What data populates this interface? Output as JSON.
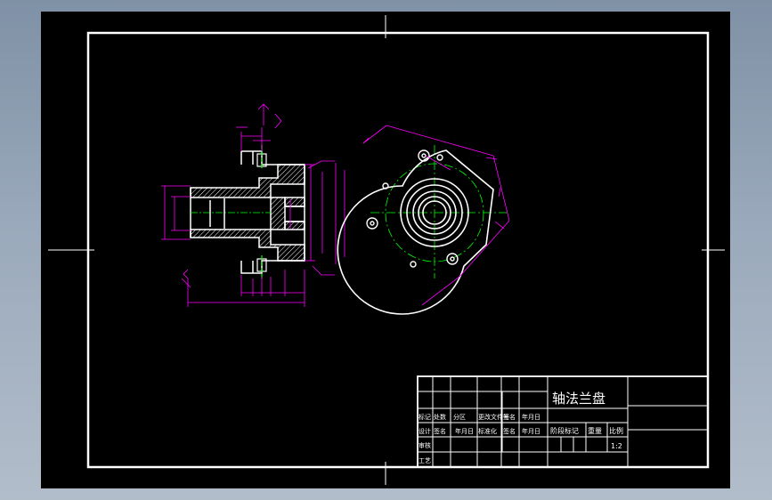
{
  "title_block": {
    "part_name": "轴法兰盘",
    "row_a": [
      "标记",
      "处数",
      "分区",
      "更改文件号",
      "签名",
      "年月日"
    ],
    "row_b": [
      "设计",
      "签名",
      "年月日",
      "标准化",
      "签名",
      "年月日"
    ],
    "row_c": [
      "审核"
    ],
    "row_d": [
      "工艺"
    ],
    "stage_label": "阶段标记",
    "weight_label": "重量",
    "scale_label": "比例",
    "scale_value": "1:2"
  },
  "colors": {
    "background": "#000000",
    "frame": "#ffffff",
    "outline": "#ffffff",
    "dimension": "#ff00ff",
    "centerline": "#00ff00",
    "hatch": "#ffffff"
  }
}
